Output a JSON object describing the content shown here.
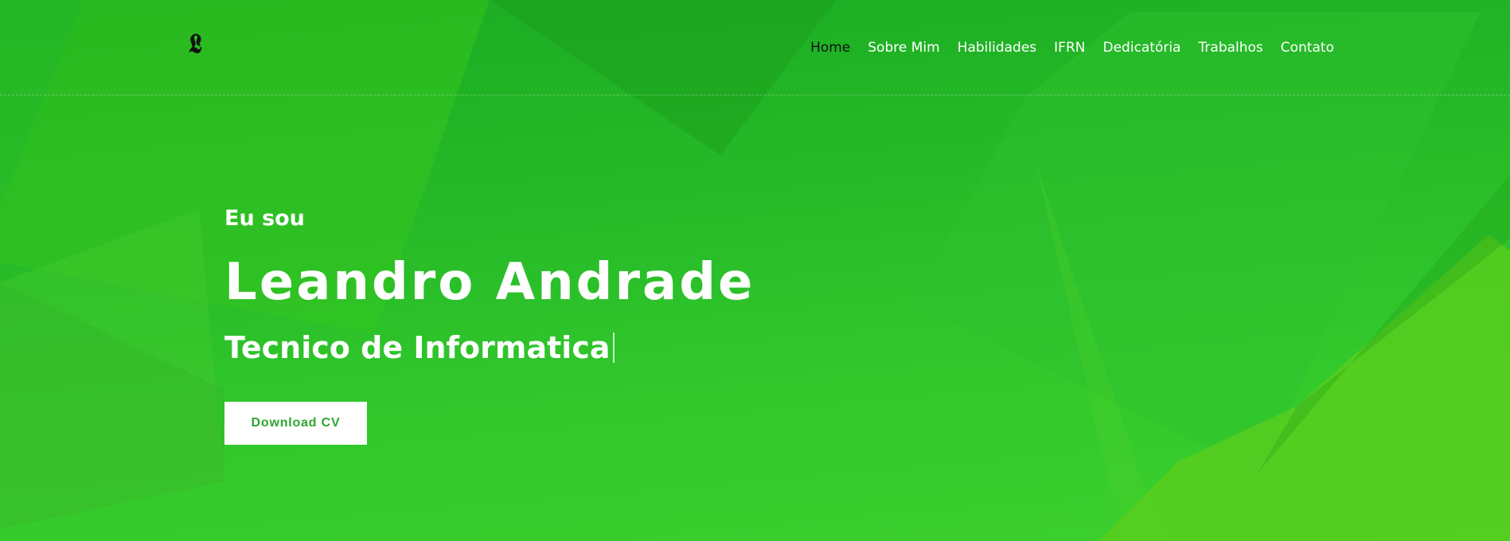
{
  "logo": {
    "text": "𝕷"
  },
  "nav": {
    "items": [
      {
        "label": "Home"
      },
      {
        "label": "Sobre Mim"
      },
      {
        "label": "Habilidades"
      },
      {
        "label": "IFRN"
      },
      {
        "label": "Dedicatória"
      },
      {
        "label": "Trabalhos"
      },
      {
        "label": "Contato"
      }
    ],
    "active_index": 0
  },
  "hero": {
    "greeting": "Eu sou",
    "name": "Leandro Andrade",
    "role": "Tecnico de Informatica",
    "button_label": "Download CV"
  },
  "colors": {
    "background": "#25b928",
    "text": "#ffffff",
    "active_nav": "#111111",
    "button_bg": "#ffffff",
    "button_text": "#2ea52f"
  }
}
